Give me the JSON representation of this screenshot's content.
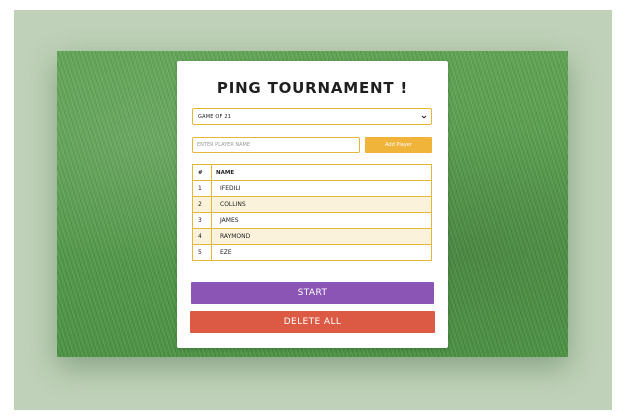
{
  "app": {
    "title": "PING TOURNAMENT !"
  },
  "game_select": {
    "selected": "GAME OF 21",
    "icon": "chevron-down-icon"
  },
  "player_input": {
    "value": "",
    "placeholder": "ENTER PLAYER NAME"
  },
  "add_button": {
    "label": "Add Player"
  },
  "table": {
    "headers": [
      "#",
      "NAME"
    ],
    "rows": [
      {
        "num": "1",
        "name": "IFEDILI"
      },
      {
        "num": "2",
        "name": "COLLINS"
      },
      {
        "num": "3",
        "name": "JAMES"
      },
      {
        "num": "4",
        "name": "RAYMOND"
      },
      {
        "num": "5",
        "name": "EZE"
      }
    ]
  },
  "start_button": {
    "label": "START"
  },
  "delete_button": {
    "label": "DELETE ALL"
  },
  "colors": {
    "backdrop": "#bfd2b9",
    "accent_border": "#e2b73a",
    "add_button": "#f0b43a",
    "start_button": "#8a55b4",
    "delete_button": "#dc5a44",
    "row_stripe": "#fbf2dc"
  }
}
